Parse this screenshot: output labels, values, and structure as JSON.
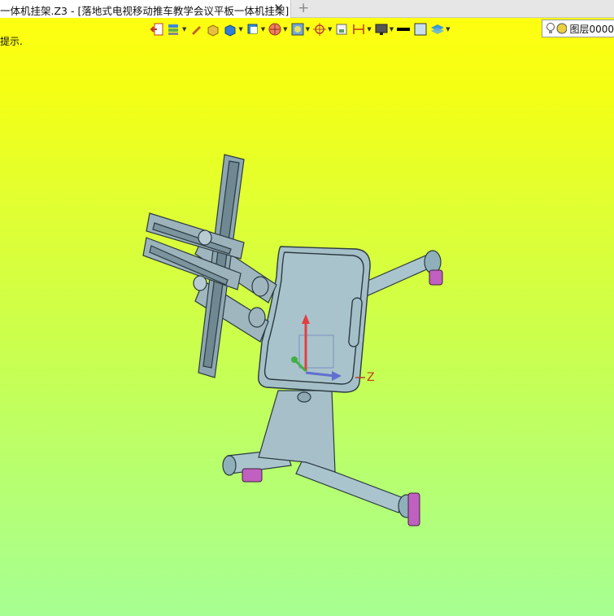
{
  "tab": {
    "title": "一体机挂架.Z3 - [落地式电视移动推车教学会议平板一体机挂架]",
    "close_symbol": "✕",
    "add_symbol": "+"
  },
  "viewport": {
    "hint": "提示.",
    "axis_label": "Z",
    "background_top": "#ffff10",
    "background_bottom": "#a6ff92"
  },
  "toolbar": {
    "buttons": [
      {
        "icon": "exit-icon"
      },
      {
        "icon": "layers-stack-icon",
        "dropdown": true
      },
      {
        "icon": "pen-icon"
      },
      {
        "icon": "box-shade-icon"
      },
      {
        "icon": "box-blue-icon",
        "dropdown": true
      },
      {
        "icon": "view-cube-icon",
        "dropdown": true
      },
      {
        "icon": "section-icon",
        "dropdown": true
      },
      {
        "icon": "display-mode-icon",
        "dropdown": true
      },
      {
        "icon": "snap-icon",
        "dropdown": true
      },
      {
        "icon": "sheet-icon"
      },
      {
        "icon": "dimension-icon",
        "dropdown": true
      },
      {
        "icon": "monitor-icon",
        "dropdown": true
      },
      {
        "icon": "line-style-icon"
      },
      {
        "icon": "color-swatch-icon"
      },
      {
        "icon": "layer-stack-icon",
        "dropdown": true
      }
    ],
    "layer": {
      "label": "图层0000"
    }
  }
}
